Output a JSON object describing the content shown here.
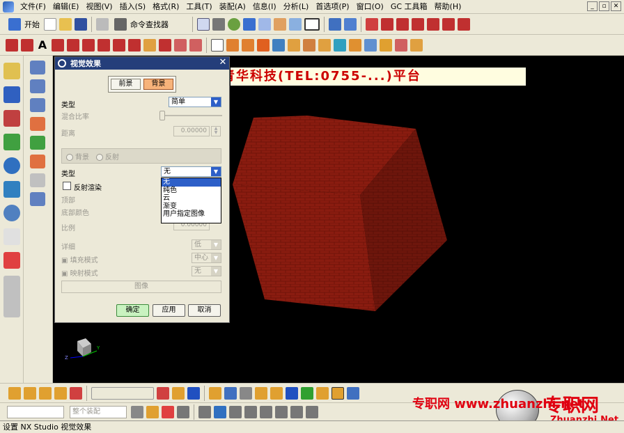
{
  "menu": [
    "文件(F)",
    "编辑(E)",
    "视图(V)",
    "插入(S)",
    "格式(R)",
    "工具(T)",
    "装配(A)",
    "信息(I)",
    "分析(L)",
    "首选项(P)",
    "窗口(O)",
    "GC 工具箱",
    "帮助(H)"
  ],
  "toolbar1": {
    "start_label": "开始",
    "command_finder_label": "命令查找器"
  },
  "banner_text": "青华科技(TEL:0755-...)平台",
  "dialog": {
    "title": "视觉效果",
    "tabs": [
      "前景",
      "背景"
    ],
    "active_tab": "背景",
    "type_label": "类型",
    "type_value": "简单",
    "mix_label": "混合比率",
    "distance_label": "距离",
    "distance_value": "0.00000",
    "radio_background": "背景",
    "radio_reflection": "反射",
    "type2_label": "类型",
    "type2_value": "无",
    "dropdown_options": [
      "无",
      "纯色",
      "云",
      "渐变",
      "用户指定图像"
    ],
    "dropdown_selected": "无",
    "reflect_label": "反射渲染",
    "top_label": "顶部",
    "bottom_color_label": "底部颜色",
    "scale_label": "比例",
    "scale_value": "0.00000",
    "detail_label": "详细",
    "detail_value": "低",
    "fill_label": "填充模式",
    "fill_value": "中心",
    "map_label": "映射模式",
    "map_value": "无",
    "image_button": "图像",
    "ok": "确定",
    "apply": "应用",
    "cancel": "取消"
  },
  "bottom": {
    "filter_label": "整个装配"
  },
  "status_text": "设置 NX Studio 视觉效果",
  "watermark": {
    "line1": "专职网 www.zhuanzhi.net",
    "line2": "专职网",
    "line3": "Zhuanzhi.Net"
  },
  "colors": {
    "cube": "#8a1c10",
    "dialog_title": "#243e7a",
    "accent": "#2d5fc8"
  }
}
